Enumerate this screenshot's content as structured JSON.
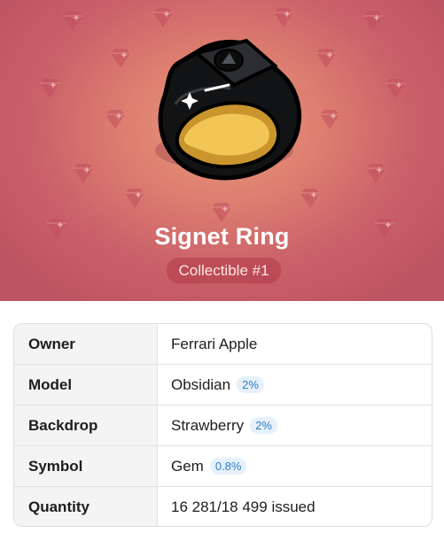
{
  "hero": {
    "title": "Signet Ring",
    "subtitle": "Collectible #1",
    "background_color": "#d8746c",
    "pattern_icon": "gem-icon",
    "art_icon": "signet-ring-icon"
  },
  "table": {
    "rows": [
      {
        "key": "Owner",
        "value": "Ferrari Apple",
        "percent": ""
      },
      {
        "key": "Model",
        "value": "Obsidian",
        "percent": "2%"
      },
      {
        "key": "Backdrop",
        "value": "Strawberry",
        "percent": "2%"
      },
      {
        "key": "Symbol",
        "value": "Gem",
        "percent": "0.8%"
      },
      {
        "key": "Quantity",
        "value": "16 281/18 499 issued",
        "percent": ""
      }
    ]
  },
  "colors": {
    "percent_text": "#2f7fc4",
    "percent_bg": "#e6f1fb"
  }
}
